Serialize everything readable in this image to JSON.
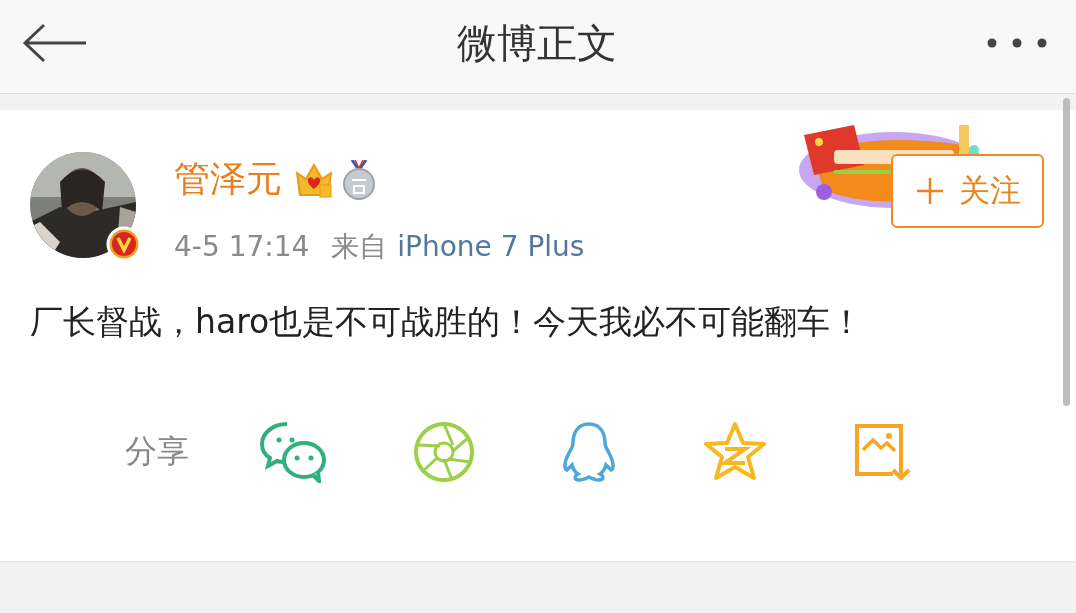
{
  "header": {
    "title": "微博正文"
  },
  "post": {
    "author": "管泽元",
    "verified": true,
    "time": "4-5 17:14",
    "source_prefix": "来自",
    "source": "iPhone 7 Plus",
    "follow_label": "关注",
    "text": "厂长督战，haro也是不可战胜的！今天我必不可能翻车！"
  },
  "share": {
    "label": "分享",
    "targets": [
      {
        "kind": "chat"
      },
      {
        "kind": "shutter"
      },
      {
        "kind": "penguin"
      },
      {
        "kind": "star"
      },
      {
        "kind": "save"
      }
    ]
  }
}
